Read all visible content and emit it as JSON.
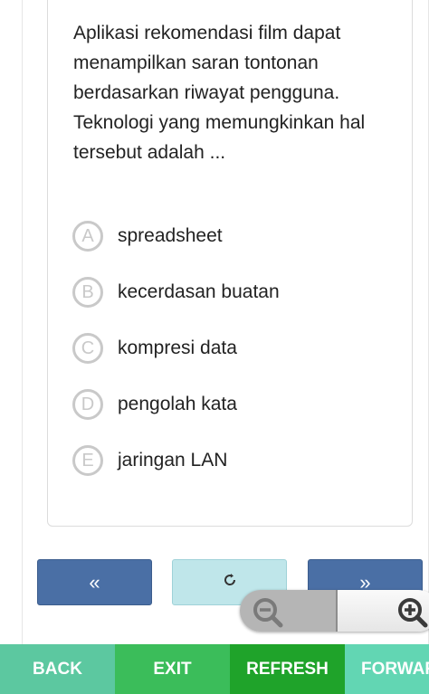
{
  "question": {
    "text": "Aplikasi rekomendasi film dapat menampilkan saran tontonan berdasarkan riwayat pengguna. Teknologi yang memungkinkan hal tersebut adalah ..."
  },
  "options": [
    {
      "letter": "A",
      "label": "spreadsheet"
    },
    {
      "letter": "B",
      "label": "kecerdasan buatan"
    },
    {
      "letter": "C",
      "label": "kompresi data"
    },
    {
      "letter": "D",
      "label": "pengolah kata"
    },
    {
      "letter": "E",
      "label": "jaringan LAN"
    }
  ],
  "navigation": {
    "prev_label": "«",
    "next_label": "»",
    "reload_icon": "reload-icon"
  },
  "zoom": {
    "out_icon": "zoom-out-icon",
    "in_icon": "zoom-in-icon"
  },
  "bottom_bar": {
    "back_label": "BACK",
    "exit_label": "EXIT",
    "refresh_label": "REFRESH",
    "forward_label": "FORWAR"
  },
  "colors": {
    "nav_blue": "#4a6fa5",
    "reload_teal": "#bfe6ea",
    "back_green": "#5cc8a0",
    "exit_green": "#3bbd5a",
    "refresh_green": "#1fa32a",
    "forward_green": "#62d6b3",
    "option_circle": "#c9c9c9"
  }
}
